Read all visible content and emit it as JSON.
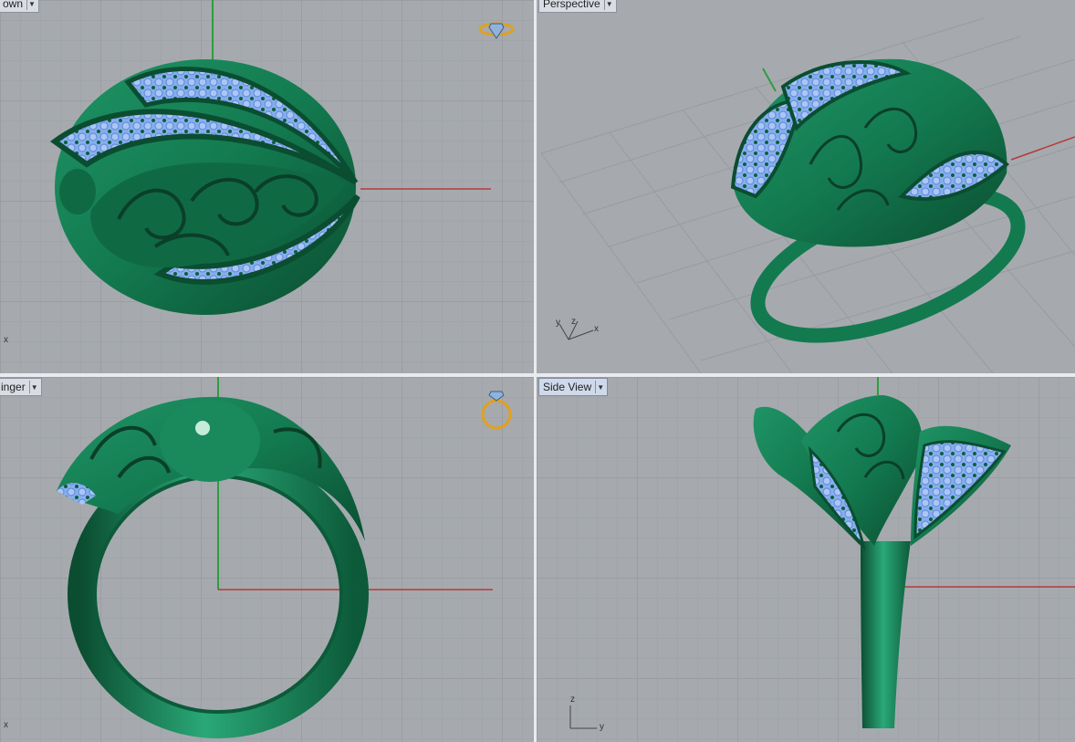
{
  "viewports": {
    "top": {
      "label": "own",
      "x_axis": "x"
    },
    "perspective": {
      "label": "Perspective",
      "x_axis": "x",
      "y_axis": "y",
      "z_axis": "z"
    },
    "front": {
      "label": "inger",
      "x_axis": "x"
    },
    "side": {
      "label": "Side View",
      "y_axis": "y",
      "z_axis": "z"
    }
  },
  "icons": {
    "ring_top": "ring-top-icon",
    "ring_front": "ring-front-icon"
  },
  "colors": {
    "metal": "#137a4f",
    "gem": "#86aef0",
    "x_axis": "#b33a3a",
    "y_axis": "#2e9e3e",
    "background": "#a6aaae",
    "grid": "#959a9f"
  }
}
